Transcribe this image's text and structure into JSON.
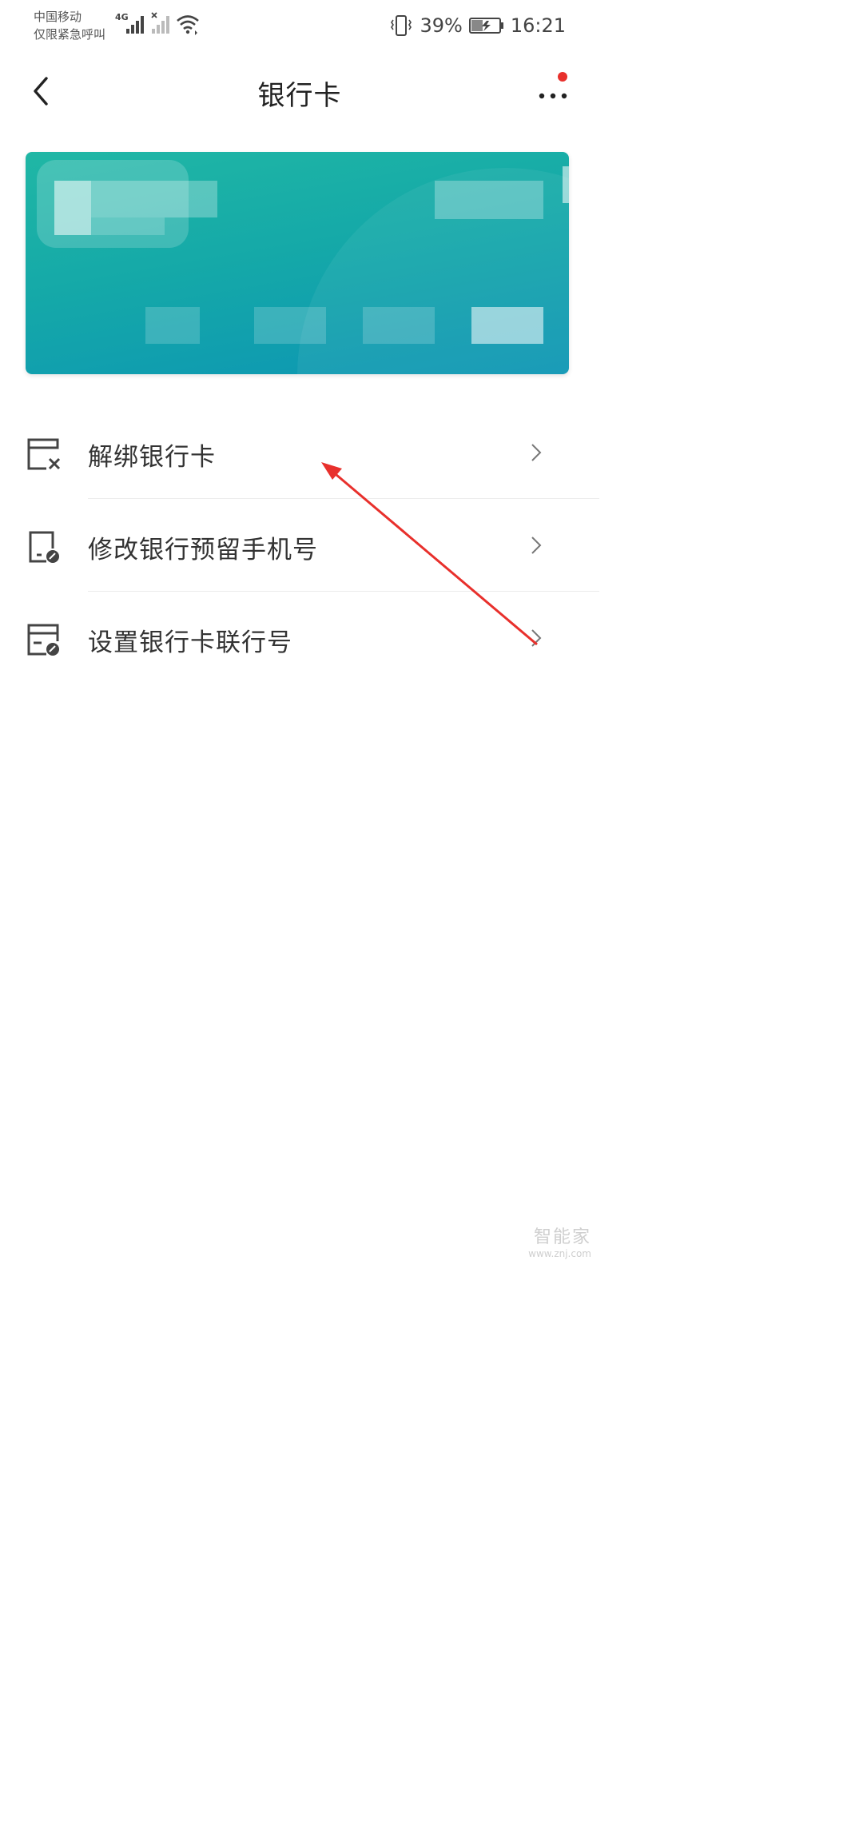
{
  "status_bar": {
    "carrier_line1": "中国移动",
    "carrier_line2": "仅限紧急呼叫",
    "network_type": "4G",
    "battery_percent": "39%",
    "time": "16:21",
    "icons": [
      "signal-4g-icon",
      "signal-no-sim-icon",
      "wifi-icon",
      "vibrate-icon",
      "battery-charging-icon"
    ]
  },
  "nav": {
    "title": "银行卡",
    "back_icon": "back-arrow-icon",
    "more_icon": "more-dots-icon",
    "has_notification_dot": true
  },
  "card": {
    "note": "",
    "colors": {
      "start": "#20b7a5",
      "end": "#0c95b4"
    }
  },
  "menu": {
    "items": [
      {
        "label": "解绑银行卡",
        "icon": "card-remove-icon"
      },
      {
        "label": "修改银行预留手机号",
        "icon": "phone-edit-icon"
      },
      {
        "label": "设置银行卡联行号",
        "icon": "card-edit-icon"
      }
    ]
  },
  "watermark": {
    "brand": "智能家",
    "url": "www.znj.com"
  },
  "colors": {
    "accent_red": "#e8302c",
    "text_primary": "#333333",
    "divider": "#ececec"
  }
}
